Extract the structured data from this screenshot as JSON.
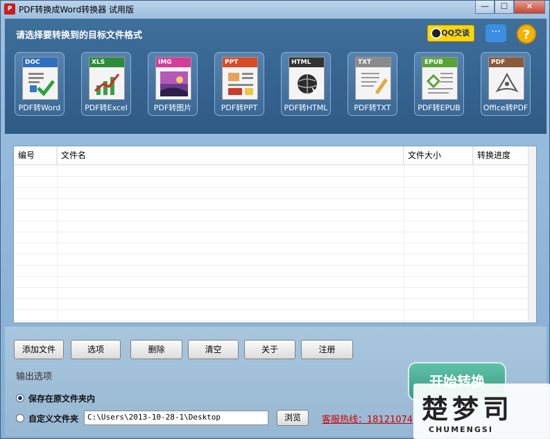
{
  "window": {
    "app_icon": "pdf-icon",
    "title": "PDF转换成Word转换器 试用版",
    "minimize": "—",
    "maximize": "☐",
    "close": "✕"
  },
  "header": {
    "prompt": "请选择要转换到的目标文件格式",
    "qq_button": "QQ交谈",
    "chat_icon": "chat-bubble-icon",
    "help_icon": "question-mark-icon",
    "help_glyph": "?"
  },
  "formats": [
    {
      "tag": "DOC",
      "label": "PDF转Word",
      "color": "#2f6fc0",
      "icon": "word-doc-icon"
    },
    {
      "tag": "XLS",
      "label": "PDF转Excel",
      "color": "#2e8b3a",
      "icon": "excel-chart-icon"
    },
    {
      "tag": "IMG",
      "label": "PDF转图片",
      "color": "#d63d97",
      "icon": "image-icon"
    },
    {
      "tag": "PPT",
      "label": "PDF转PPT",
      "color": "#d94b25",
      "icon": "ppt-icon"
    },
    {
      "tag": "HTML",
      "label": "PDF转HTML",
      "color": "#333333",
      "icon": "html-globe-icon"
    },
    {
      "tag": "TXT",
      "label": "PDF转TXT",
      "color": "#8a8a8a",
      "icon": "txt-pencil-icon"
    },
    {
      "tag": "EPUB",
      "label": "PDF转EPUB",
      "color": "#5aa23a",
      "icon": "epub-icon"
    },
    {
      "tag": "PDF",
      "label": "Office转PDF",
      "color": "#8a5a3a",
      "icon": "pdf-acrobat-icon"
    }
  ],
  "table": {
    "columns": [
      "编号",
      "文件名",
      "文件大小",
      "转换进度"
    ],
    "rows": []
  },
  "toolbar": {
    "add_file": "添加文件",
    "options": "选项",
    "delete": "删除",
    "clear": "清空",
    "about": "关于",
    "register": "注册",
    "start": "开始转换"
  },
  "output": {
    "title": "输出选项",
    "keep_original": "保存在原文件夹内",
    "custom_folder": "自定义文件夹",
    "path_value": "C:\\Users\\2013-10-28-1\\Desktop",
    "browse": "浏览",
    "hotline": "客服热线：18121074",
    "selected": "keep_original"
  },
  "watermark": {
    "cn": "楚梦司",
    "en": "CHUMENGSI"
  }
}
